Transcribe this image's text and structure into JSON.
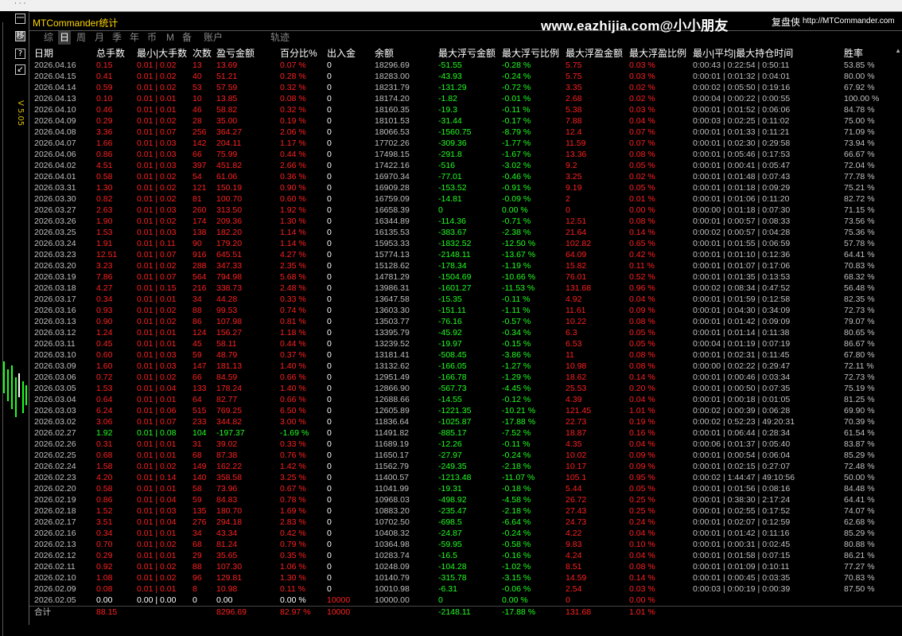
{
  "window_title": "MTCommander统计",
  "watermark": "www.eazhijia.com@小小朋友",
  "replay_label": "复盘侠",
  "url_label": "http://MTCommander.com",
  "sidebar": {
    "version": "V 5.05",
    "buttons": [
      "一",
      "移",
      "?",
      "↙"
    ]
  },
  "tabs": [
    "综",
    "日",
    "周",
    "月",
    "季",
    "年",
    "币",
    "M",
    "备",
    "账户",
    "轨迹"
  ],
  "active_tab": "日",
  "columns": [
    "日期",
    "总手数",
    "最小|大手数",
    "次数",
    "盈亏金额",
    "百分比%",
    "出入金",
    "余额",
    "最大浮亏金额",
    "最大浮亏比例",
    "最大浮盈金额",
    "最大浮盈比例",
    "最小|平均|最大持仓时间",
    "胜率"
  ],
  "rows": [
    [
      "2026.04.16",
      "0.15",
      "0.01 | 0.02",
      "13",
      "13.69",
      "0.07 %",
      "0",
      "18296.69",
      "-51.55",
      "-0.28 %",
      "5.75",
      "0.03 %",
      "0:00:43 | 0:22:54 | 0:50:11",
      "53.85 %"
    ],
    [
      "2026.04.15",
      "0.41",
      "0.01 | 0.02",
      "40",
      "51.21",
      "0.28 %",
      "0",
      "18283.00",
      "-43.93",
      "-0.24 %",
      "5.75",
      "0.03 %",
      "0:00:01 | 0:01:32 | 0:04:01",
      "80.00 %"
    ],
    [
      "2026.04.14",
      "0.59",
      "0.01 | 0.02",
      "53",
      "57.59",
      "0.32 %",
      "0",
      "18231.79",
      "-131.29",
      "-0.72 %",
      "3.35",
      "0.02 %",
      "0:00:02 | 0:05:50 | 0:19:16",
      "67.92 %"
    ],
    [
      "2026.04.13",
      "0.10",
      "0.01 | 0.01",
      "10",
      "13.85",
      "0.08 %",
      "0",
      "18174.20",
      "-1.82",
      "-0.01 %",
      "2.68",
      "0.02 %",
      "0:00:04 | 0:00:22 | 0:00:55",
      "100.00 %"
    ],
    [
      "2026.04.10",
      "0.46",
      "0.01 | 0.01",
      "46",
      "58.82",
      "0.32 %",
      "0",
      "18160.35",
      "-19.3",
      "-0.11 %",
      "5.38",
      "0.03 %",
      "0:00:01 | 0:01:52 | 0:06:06",
      "84.78 %"
    ],
    [
      "2026.04.09",
      "0.29",
      "0.01 | 0.02",
      "28",
      "35.00",
      "0.19 %",
      "0",
      "18101.53",
      "-31.44",
      "-0.17 %",
      "7.88",
      "0.04 %",
      "0:00:03 | 0:02:25 | 0:11:02",
      "75.00 %"
    ],
    [
      "2026.04.08",
      "3.36",
      "0.01 | 0.07",
      "256",
      "364.27",
      "2.06 %",
      "0",
      "18066.53",
      "-1560.75",
      "-8.79 %",
      "12.4",
      "0.07 %",
      "0:00:01 | 0:01:33 | 0:11:21",
      "71.09 %"
    ],
    [
      "2026.04.07",
      "1.66",
      "0.01 | 0.03",
      "142",
      "204.11",
      "1.17 %",
      "0",
      "17702.26",
      "-309.36",
      "-1.77 %",
      "11.59",
      "0.07 %",
      "0:00:01 | 0:02:30 | 0:29:58",
      "73.94 %"
    ],
    [
      "2026.04.06",
      "0.86",
      "0.01 | 0.03",
      "66",
      "75.99",
      "0.44 %",
      "0",
      "17498.15",
      "-291.8",
      "-1.67 %",
      "13.36",
      "0.08 %",
      "0:00:01 | 0:05:46 | 0:17:53",
      "66.67 %"
    ],
    [
      "2026.04.02",
      "4.51",
      "0.01 | 0.03",
      "397",
      "451.82",
      "2.66 %",
      "0",
      "17422.16",
      "-516",
      "-3.02 %",
      "9.2",
      "0.05 %",
      "0:00:01 | 0:00:41 | 0:05:47",
      "72.04 %"
    ],
    [
      "2026.04.01",
      "0.58",
      "0.01 | 0.02",
      "54",
      "61.06",
      "0.36 %",
      "0",
      "16970.34",
      "-77.01",
      "-0.46 %",
      "3.25",
      "0.02 %",
      "0:00:01 | 0:01:48 | 0:07:43",
      "77.78 %"
    ],
    [
      "2026.03.31",
      "1.30",
      "0.01 | 0.02",
      "121",
      "150.19",
      "0.90 %",
      "0",
      "16909.28",
      "-153.52",
      "-0.91 %",
      "9.19",
      "0.05 %",
      "0:00:01 | 0:01:18 | 0:09:29",
      "75.21 %"
    ],
    [
      "2026.03.30",
      "0.82",
      "0.01 | 0.02",
      "81",
      "100.70",
      "0.60 %",
      "0",
      "16759.09",
      "-14.81",
      "-0.09 %",
      "2",
      "0.01 %",
      "0:00:01 | 0:01:06 | 0:11:20",
      "82.72 %"
    ],
    [
      "2026.03.27",
      "2.63",
      "0.01 | 0.03",
      "260",
      "313.50",
      "1.92 %",
      "0",
      "16658.39",
      "0",
      "0.00 %",
      "0",
      "0.00 %",
      "0:00:00 | 0:01:18 | 0:07:30",
      "71.15 %"
    ],
    [
      "2026.03.26",
      "1.90",
      "0.01 | 0.02",
      "174",
      "209.36",
      "1.30 %",
      "0",
      "16344.89",
      "-114.36",
      "-0.71 %",
      "12.51",
      "0.08 %",
      "0:00:01 | 0:00:57 | 0:08:33",
      "73.56 %"
    ],
    [
      "2026.03.25",
      "1.53",
      "0.01 | 0.03",
      "138",
      "182.20",
      "1.14 %",
      "0",
      "16135.53",
      "-383.67",
      "-2.38 %",
      "21.64",
      "0.14 %",
      "0:00:02 | 0:00:57 | 0:04:28",
      "75.36 %"
    ],
    [
      "2026.03.24",
      "1.91",
      "0.01 | 0.11",
      "90",
      "179.20",
      "1.14 %",
      "0",
      "15953.33",
      "-1832.52",
      "-12.50 %",
      "102.82",
      "0.65 %",
      "0:00:01 | 0:01:55 | 0:06:59",
      "57.78 %"
    ],
    [
      "2026.03.23",
      "12.51",
      "0.01 | 0.07",
      "916",
      "645.51",
      "4.27 %",
      "0",
      "15774.13",
      "-2148.11",
      "-13.67 %",
      "64.09",
      "0.42 %",
      "0:00:01 | 0:01:10 | 0:12:36",
      "64.41 %"
    ],
    [
      "2026.03.20",
      "3.23",
      "0.01 | 0.02",
      "288",
      "347.33",
      "2.35 %",
      "0",
      "15128.62",
      "-178.34",
      "-1.19 %",
      "15.82",
      "0.11 %",
      "0:00:01 | 0:01:07 | 0:17:06",
      "70.83 %"
    ],
    [
      "2026.03.19",
      "7.86",
      "0.01 | 0.07",
      "564",
      "794.98",
      "5.68 %",
      "0",
      "14781.29",
      "-1504.69",
      "-10.66 %",
      "76.01",
      "0.52 %",
      "0:00:01 | 0:01:35 | 0:13:53",
      "68.32 %"
    ],
    [
      "2026.03.18",
      "4.27",
      "0.01 | 0.15",
      "216",
      "338.73",
      "2.48 %",
      "0",
      "13986.31",
      "-1601.27",
      "-11.53 %",
      "131.68",
      "0.96 %",
      "0:00:02 | 0:08:34 | 0:47:52",
      "56.48 %"
    ],
    [
      "2026.03.17",
      "0.34",
      "0.01 | 0.01",
      "34",
      "44.28",
      "0.33 %",
      "0",
      "13647.58",
      "-15.35",
      "-0.11 %",
      "4.92",
      "0.04 %",
      "0:00:01 | 0:01:59 | 0:12:58",
      "82.35 %"
    ],
    [
      "2026.03.16",
      "0.93",
      "0.01 | 0.02",
      "88",
      "99.53",
      "0.74 %",
      "0",
      "13603.30",
      "-151.11",
      "-1.11 %",
      "11.61",
      "0.09 %",
      "0:00:01 | 0:04:30 | 0:34:09",
      "72.73 %"
    ],
    [
      "2026.03.13",
      "0.90",
      "0.01 | 0.02",
      "86",
      "107.98",
      "0.81 %",
      "0",
      "13503.77",
      "-76.16",
      "-0.57 %",
      "10.22",
      "0.08 %",
      "0:00:01 | 0:01:42 | 0:09:09",
      "79.07 %"
    ],
    [
      "2026.03.12",
      "1.24",
      "0.01 | 0.01",
      "124",
      "156.27",
      "1.18 %",
      "0",
      "13395.79",
      "-45.92",
      "-0.34 %",
      "6.3",
      "0.05 %",
      "0:00:01 | 0:01:14 | 0:11:38",
      "80.65 %"
    ],
    [
      "2026.03.11",
      "0.45",
      "0.01 | 0.01",
      "45",
      "58.11",
      "0.44 %",
      "0",
      "13239.52",
      "-19.97",
      "-0.15 %",
      "6.53",
      "0.05 %",
      "0:00:04 | 0:01:19 | 0:07:19",
      "86.67 %"
    ],
    [
      "2026.03.10",
      "0.60",
      "0.01 | 0.03",
      "59",
      "48.79",
      "0.37 %",
      "0",
      "13181.41",
      "-508.45",
      "-3.86 %",
      "11",
      "0.08 %",
      "0:00:01 | 0:02:31 | 0:11:45",
      "67.80 %"
    ],
    [
      "2026.03.09",
      "1.60",
      "0.01 | 0.03",
      "147",
      "181.13",
      "1.40 %",
      "0",
      "13132.62",
      "-166.05",
      "-1.27 %",
      "10.98",
      "0.08 %",
      "0:00:00 | 0:02:22 | 0:29:47",
      "72.11 %"
    ],
    [
      "2026.03.06",
      "0.72",
      "0.01 | 0.02",
      "66",
      "84.59",
      "0.66 %",
      "0",
      "12951.49",
      "-166.78",
      "-1.29 %",
      "18.62",
      "0.14 %",
      "0:00:01 | 0:00:46 | 0:03:34",
      "72.73 %"
    ],
    [
      "2026.03.05",
      "1.53",
      "0.01 | 0.04",
      "133",
      "178.24",
      "1.40 %",
      "0",
      "12866.90",
      "-567.73",
      "-4.45 %",
      "25.53",
      "0.20 %",
      "0:00:01 | 0:00:50 | 0:07:35",
      "75.19 %"
    ],
    [
      "2026.03.04",
      "0.64",
      "0.01 | 0.01",
      "64",
      "82.77",
      "0.66 %",
      "0",
      "12688.66",
      "-14.55",
      "-0.12 %",
      "4.39",
      "0.04 %",
      "0:00:01 | 0:00:18 | 0:01:05",
      "81.25 %"
    ],
    [
      "2026.03.03",
      "6.24",
      "0.01 | 0.06",
      "515",
      "769.25",
      "6.50 %",
      "0",
      "12605.89",
      "-1221.35",
      "-10.21 %",
      "121.45",
      "1.01 %",
      "0:00:02 | 0:00:39 | 0:06:28",
      "69.90 %"
    ],
    [
      "2026.03.02",
      "3.06",
      "0.01 | 0.07",
      "233",
      "344.82",
      "3.00 %",
      "0",
      "11836.64",
      "-1025.87",
      "-17.88 %",
      "22.73",
      "0.19 %",
      "0:00:02 | 0:52:23 | 49:20:31",
      "70.39 %"
    ],
    [
      "2026.02.27",
      "1.92",
      "0.01 | 0.08",
      "104",
      "-197.37",
      "-1.69 %",
      "0",
      "11491.82",
      "-885.17",
      "-7.52 %",
      "18.87",
      "0.16 %",
      "0:00:01 | 0:06:44 | 0:28:34",
      "61.54 %"
    ],
    [
      "2026.02.26",
      "0.31",
      "0.01 | 0.01",
      "31",
      "39.02",
      "0.33 %",
      "0",
      "11689.19",
      "-12.26",
      "-0.11 %",
      "4.35",
      "0.04 %",
      "0:00:06 | 0:01:37 | 0:05:40",
      "83.87 %"
    ],
    [
      "2026.02.25",
      "0.68",
      "0.01 | 0.01",
      "68",
      "87.38",
      "0.76 %",
      "0",
      "11650.17",
      "-27.97",
      "-0.24 %",
      "10.02",
      "0.09 %",
      "0:00:01 | 0:00:54 | 0:06:04",
      "85.29 %"
    ],
    [
      "2026.02.24",
      "1.58",
      "0.01 | 0.02",
      "149",
      "162.22",
      "1.42 %",
      "0",
      "11562.79",
      "-249.35",
      "-2.18 %",
      "10.17",
      "0.09 %",
      "0:00:01 | 0:02:15 | 0:27:07",
      "72.48 %"
    ],
    [
      "2026.02.23",
      "4.20",
      "0.01 | 0.14",
      "140",
      "358.58",
      "3.25 %",
      "0",
      "11400.57",
      "-1213.48",
      "-11.07 %",
      "105.1",
      "0.95 %",
      "0:00:02 | 1:44:47 | 49:10:56",
      "50.00 %"
    ],
    [
      "2026.02.20",
      "0.58",
      "0.01 | 0.01",
      "58",
      "73.96",
      "0.67 %",
      "0",
      "11041.99",
      "-19.31",
      "-0.18 %",
      "5.44",
      "0.05 %",
      "0:00:01 | 0:01:56 | 0:08:16",
      "84.48 %"
    ],
    [
      "2026.02.19",
      "0.86",
      "0.01 | 0.04",
      "59",
      "84.83",
      "0.78 %",
      "0",
      "10968.03",
      "-498.92",
      "-4.58 %",
      "26.72",
      "0.25 %",
      "0:00:01 | 0:38:30 | 2:17:24",
      "64.41 %"
    ],
    [
      "2026.02.18",
      "1.52",
      "0.01 | 0.03",
      "135",
      "180.70",
      "1.69 %",
      "0",
      "10883.20",
      "-235.47",
      "-2.18 %",
      "27.43",
      "0.25 %",
      "0:00:01 | 0:02:55 | 0:17:52",
      "74.07 %"
    ],
    [
      "2026.02.17",
      "3.51",
      "0.01 | 0.04",
      "276",
      "294.18",
      "2.83 %",
      "0",
      "10702.50",
      "-698.5",
      "-6.64 %",
      "24.73",
      "0.24 %",
      "0:00:01 | 0:02:07 | 0:12:59",
      "62.68 %"
    ],
    [
      "2026.02.16",
      "0.34",
      "0.01 | 0.01",
      "34",
      "43.34",
      "0.42 %",
      "0",
      "10408.32",
      "-24.87",
      "-0.24 %",
      "4.22",
      "0.04 %",
      "0:00:01 | 0:01:42 | 0:11:16",
      "85.29 %"
    ],
    [
      "2026.02.13",
      "0.70",
      "0.01 | 0.02",
      "68",
      "81.24",
      "0.79 %",
      "0",
      "10364.98",
      "-59.95",
      "-0.58 %",
      "9.83",
      "0.10 %",
      "0:00:01 | 0:00:31 | 0:02:45",
      "80.88 %"
    ],
    [
      "2026.02.12",
      "0.29",
      "0.01 | 0.01",
      "29",
      "35.65",
      "0.35 %",
      "0",
      "10283.74",
      "-16.5",
      "-0.16 %",
      "4.24",
      "0.04 %",
      "0:00:01 | 0:01:58 | 0:07:15",
      "86.21 %"
    ],
    [
      "2026.02.11",
      "0.92",
      "0.01 | 0.02",
      "88",
      "107.30",
      "1.06 %",
      "0",
      "10248.09",
      "-104.28",
      "-1.02 %",
      "8.51",
      "0.08 %",
      "0:00:01 | 0:01:09 | 0:10:11",
      "77.27 %"
    ],
    [
      "2026.02.10",
      "1.08",
      "0.01 | 0.02",
      "96",
      "129.81",
      "1.30 %",
      "0",
      "10140.79",
      "-315.78",
      "-3.15 %",
      "14.59",
      "0.14 %",
      "0:00:01 | 0:00:45 | 0:03:35",
      "70.83 %"
    ],
    [
      "2026.02.09",
      "0.08",
      "0.01 | 0.01",
      "8",
      "10.98",
      "0.11 %",
      "0",
      "10010.98",
      "-6.31",
      "-0.06 %",
      "2.54",
      "0.03 %",
      "0:00:03 | 0:00:19 | 0:00:39",
      "87.50 %"
    ],
    [
      "2026.02.05",
      "0.00",
      "0.00 | 0.00",
      "0",
      "0.00",
      "0.00 %",
      "10000",
      "10000.00",
      "0",
      "0.00 %",
      "0",
      "0.00 %",
      "",
      ""
    ]
  ],
  "total_row": [
    "合计",
    "88.15",
    "",
    "",
    "8296.69",
    "82.97 %",
    "10000",
    "",
    "-2148.11",
    "-17.88 %",
    "131.68",
    "1.01 %",
    "",
    ""
  ]
}
